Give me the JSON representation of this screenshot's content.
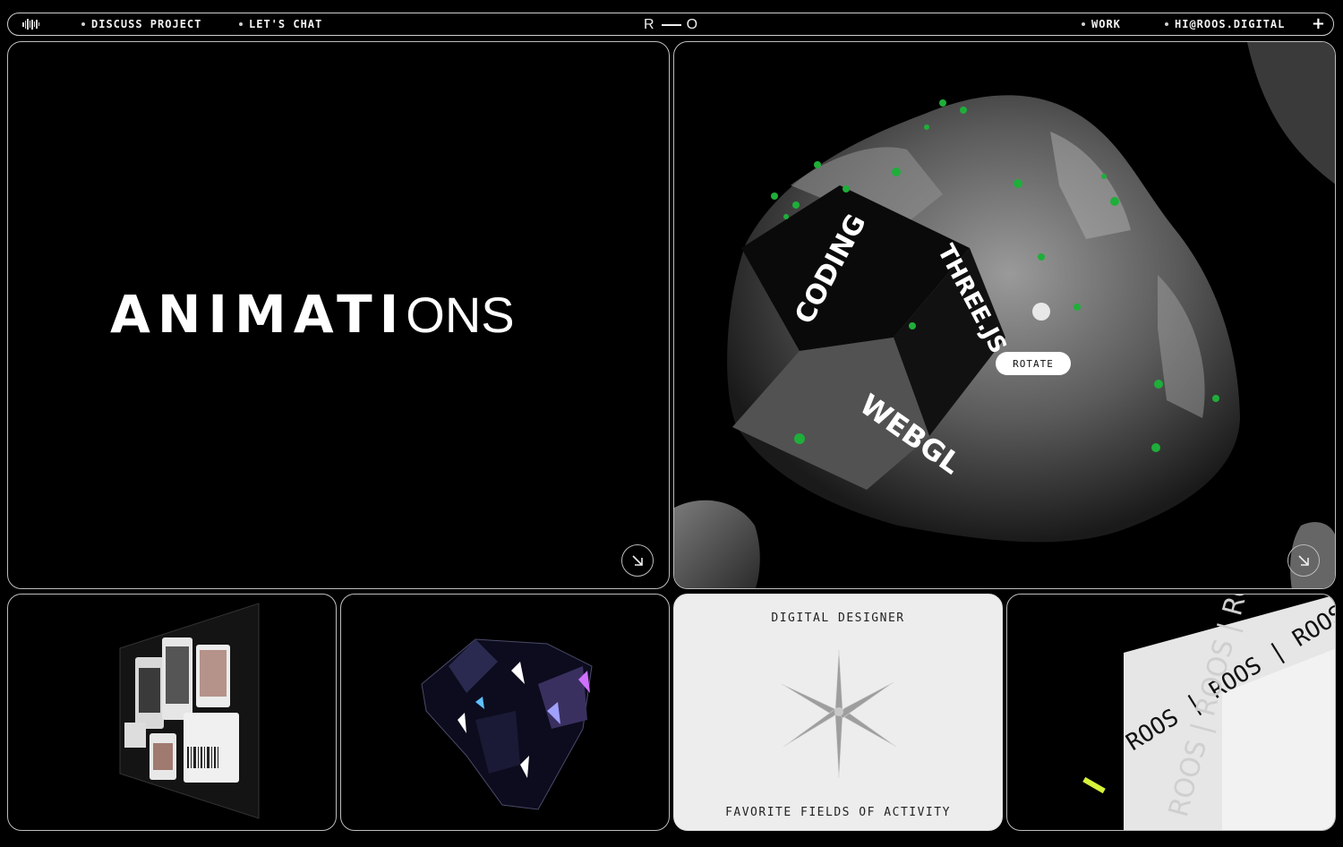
{
  "nav": {
    "discuss_label": "DISCUSS PROJECT",
    "chat_label": "LET'S CHAT",
    "logo_left": "R",
    "logo_right": "O",
    "work_label": "WORK",
    "email_label": "HI@ROOS.DIGITAL",
    "plus_label": "+"
  },
  "animations_card": {
    "title_main": "ANIMATI",
    "title_tail": "ONS"
  },
  "cube_card": {
    "rotate_label": "ROTATE",
    "face_coding": "CODING",
    "face_three": "THREE.JS",
    "face_webgl": "WEBGL"
  },
  "designer_card": {
    "top_label": "DIGITAL DESIGNER",
    "bottom_label": "FAVORITE FIELDS OF ACTIVITY"
  },
  "brand_card": {
    "tape_text": "ROOS | ROOS | ROOS | ROOS |"
  },
  "colors": {
    "accent_green": "#1fae3a",
    "tape_yellow": "#d7f23a"
  }
}
